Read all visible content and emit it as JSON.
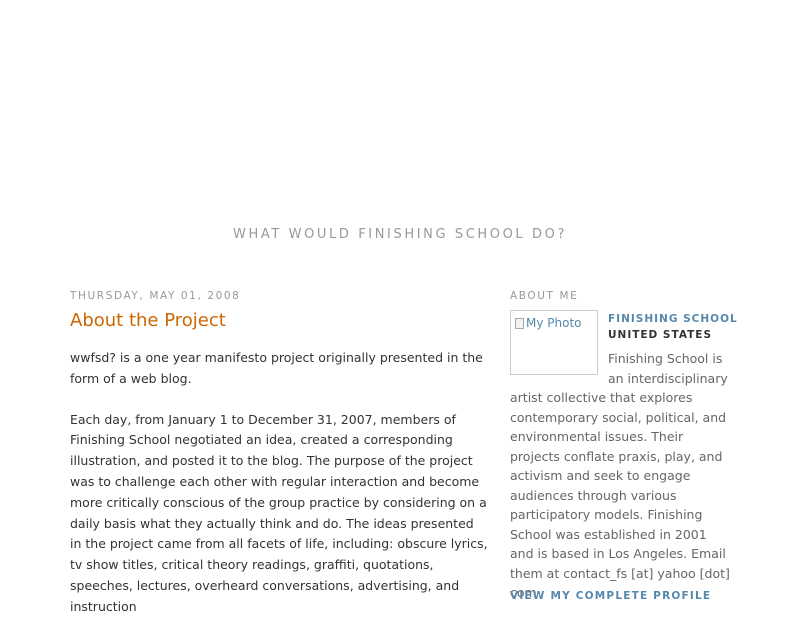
{
  "blog": {
    "title": "What would finishing school do?"
  },
  "post": {
    "date": "Thursday, May 01, 2008",
    "title": "About the Project",
    "paragraphs": [
      "wwfsd? is a one year manifesto project originally presented in the form of a web blog.",
      "Each day, from January 1 to December 31, 2007, members of Finishing School negotiated an idea, created a corresponding illustration, and posted it to the blog. The purpose of the project was to challenge each other with regular interaction and become more critically conscious of the group practice by considering on a daily basis what they actually think and do. The ideas presented in the project came from all facets of life, including: obscure lyrics, tv show titles, critical theory readings, graffiti, quotations, speeches, lectures, overheard conversations, advertising, and instruction"
    ]
  },
  "sidebar": {
    "heading": "About Me",
    "photo_alt": "My Photo",
    "profile_name": "Finishing School",
    "location": "United States",
    "description": "Finishing School is an interdisciplinary artist collective that explores contemporary social, political, and environmental issues. Their projects conflate praxis, play, and activism and seek to engage audiences through various participatory models. Finishing School was established in 2001 and is based in Los Angeles. Email them at contact_fs [at] yahoo [dot] com",
    "profile_link": "View my complete profile"
  },
  "colors": {
    "post_title": "#cc6600",
    "link": "#5588aa",
    "muted": "#999999",
    "text": "#333333"
  }
}
